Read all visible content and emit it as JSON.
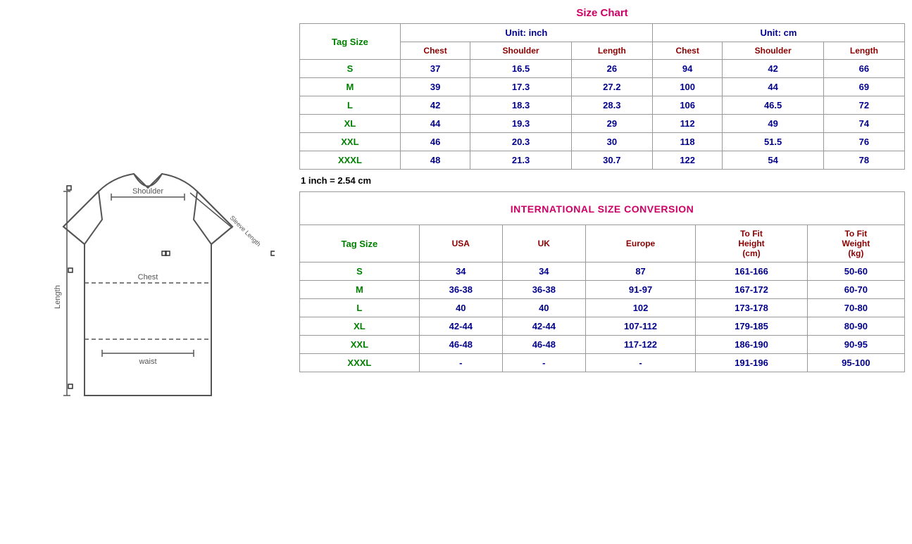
{
  "left": {
    "alt": "T-shirt measurement diagram"
  },
  "right": {
    "sizeChartTitle": "Size Chart",
    "unitInch": "Unit: inch",
    "unitCm": "Unit: cm",
    "tagSizeLabel": "Tag Size",
    "inchCols": [
      "Chest",
      "Shoulder",
      "Length"
    ],
    "cmCols": [
      "Chest",
      "Shoulder",
      "Length"
    ],
    "sizeRows": [
      {
        "tag": "S",
        "chest_in": "37",
        "shoulder_in": "16.5",
        "length_in": "26",
        "chest_cm": "94",
        "shoulder_cm": "42",
        "length_cm": "66"
      },
      {
        "tag": "M",
        "chest_in": "39",
        "shoulder_in": "17.3",
        "length_in": "27.2",
        "chest_cm": "100",
        "shoulder_cm": "44",
        "length_cm": "69"
      },
      {
        "tag": "L",
        "chest_in": "42",
        "shoulder_in": "18.3",
        "length_in": "28.3",
        "chest_cm": "106",
        "shoulder_cm": "46.5",
        "length_cm": "72"
      },
      {
        "tag": "XL",
        "chest_in": "44",
        "shoulder_in": "19.3",
        "length_in": "29",
        "chest_cm": "112",
        "shoulder_cm": "49",
        "length_cm": "74"
      },
      {
        "tag": "XXL",
        "chest_in": "46",
        "shoulder_in": "20.3",
        "length_in": "30",
        "chest_cm": "118",
        "shoulder_cm": "51.5",
        "length_cm": "76"
      },
      {
        "tag": "XXXL",
        "chest_in": "48",
        "shoulder_in": "21.3",
        "length_in": "30.7",
        "chest_cm": "122",
        "shoulder_cm": "54",
        "length_cm": "78"
      }
    ],
    "note": "1 inch = 2.54 cm",
    "conversionTitle": "INTERNATIONAL SIZE CONVERSION",
    "convTagSizeLabel": "Tag Size",
    "convCols": [
      "USA",
      "UK",
      "Europe",
      "To Fit Height (cm)",
      "To Fit Weight (kg)"
    ],
    "convRows": [
      {
        "tag": "S",
        "usa": "34",
        "uk": "34",
        "europe": "87",
        "height": "161-166",
        "weight": "50-60"
      },
      {
        "tag": "M",
        "usa": "36-38",
        "uk": "36-38",
        "europe": "91-97",
        "height": "167-172",
        "weight": "60-70"
      },
      {
        "tag": "L",
        "usa": "40",
        "uk": "40",
        "europe": "102",
        "height": "173-178",
        "weight": "70-80"
      },
      {
        "tag": "XL",
        "usa": "42-44",
        "uk": "42-44",
        "europe": "107-112",
        "height": "179-185",
        "weight": "80-90"
      },
      {
        "tag": "XXL",
        "usa": "46-48",
        "uk": "46-48",
        "europe": "117-122",
        "height": "186-190",
        "weight": "90-95"
      },
      {
        "tag": "XXXL",
        "usa": "-",
        "uk": "-",
        "europe": "-",
        "height": "191-196",
        "weight": "95-100"
      }
    ]
  }
}
